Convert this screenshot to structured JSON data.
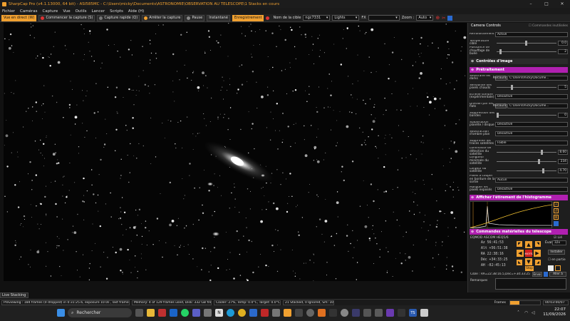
{
  "window": {
    "title": "SharpCap Pro (v4.1.13000, 64 bit) - ASI585MC - C:\\Users\\micky\\Documents\\ASTRONOMIE\\OBSERVATION AU TELESCOPE\\1 Stacks en cours",
    "minimize": "–",
    "maximize": "□",
    "close": "✕"
  },
  "menu": [
    "Fichier",
    "Caméras",
    "Capture",
    "Vue",
    "Outils",
    "Lancer",
    "Scripts",
    "Aide (H)"
  ],
  "toolbar": {
    "live_view": "Vue en direct (W)",
    "start_capture": "Commencer la capture (S)",
    "quick_capture": "Capture rapide (Q)",
    "stop_capture": "Arrêter la capture",
    "pause": "Pause",
    "snapshot": "Instantané",
    "save": "Enregistrement",
    "target_label": "Nom de la cible",
    "target_value": "ngc7331",
    "lights_value": "Lights",
    "fx_label": "FX",
    "zoom_label": "Zoom :",
    "zoom_value": "Auto"
  },
  "panel": {
    "camera_controls": "Camera Controls",
    "hide_unused": "Commandes inutilisées",
    "cooling_label": "Refroidissement",
    "cooling_value": "Activé",
    "target_temp_label": "Température cible",
    "target_temp_value": "0.0",
    "heater_label": "Puissance de chauffage de buée",
    "heater_value": "2",
    "image_controls": "Contrôles d'image",
    "preprocessing": "Prétraitement",
    "subtract_dark_label": "Soustraire les darks",
    "browse": "Parcourir...",
    "dark_path": "C:\\Users\\micky\\Docume...",
    "hot_pixel_label": "Sensibilité des pixels chauds",
    "hot_pixel_value": "5",
    "dark_scale_label": "Échelle sombre (expérimentale)",
    "dark_scale_value": "Désactivé",
    "flat_label": "Division par les flats",
    "flat_path": "C:\\Users\\micky\\Docume...",
    "banding_label": "Suppression des bandes",
    "banding_value": "0",
    "planet_label": "Stabilisation planète / disque",
    "planet_value": "Désactivé",
    "amp_glow_label": "Soustraction d'ombre plan",
    "amp_glow_value": "Désactivé",
    "trails_label": "Supprimer les traces satellites",
    "trails_value": "Faible",
    "detect_label": "Luminosité de détection du satellite",
    "detect_value": "8.60",
    "min_len_label": "Longueur minimale du satellite",
    "min_len_value": "234",
    "width_label": "Largeur du satellite",
    "width_value": "4.70",
    "border_label": "Pixels à couper en bordure de la sortie",
    "border_value": "Aucun",
    "mask_label": "Masquer les pixels exposés",
    "mask_value": "Désactivé",
    "histogram_header": "Afficher l'étirement de l'histogramme",
    "telescope_header": "Commandes matérielles du télescope",
    "mount_name": "EQMOD ASCOM HEQ5/6",
    "link_label": "Lié",
    "az": "Az   56:41:53",
    "alt": "Alt  +56:51:38",
    "ra": "RA   22:38:16",
    "dec": "Déc  +34:33:25",
    "ah": "AH   -02:45:13",
    "speed_label": "Évaluer",
    "speed_value": "32x",
    "install_label": "Installer",
    "tracking_label": "en partie",
    "center_label": "MOTS",
    "stop_label": "Stop",
    "target_text": "Cible : RA=22:38:16.5,Dec=+34:33:25",
    "goto_label": "Envoi",
    "goto_btn": "Aller à",
    "remarks_label": "Remarques"
  },
  "live_stacking": "Live Stacking",
  "status": {
    "preview": "Previewing : 184 frames (0 dropped) in 0:31:25.6, exposure 10.0s , last frame 10.0s",
    "memory": "Memory: 4 of 129 frames used, Disk: 332 GB free",
    "cooler": "Cooler: 27%, Temp: 0.0°C, Target: 0.0°C",
    "stacked": "21 Stacked, 0 Ignored, Sm: 10s",
    "frames_label": "Frames",
    "time": "00:03:00/07"
  },
  "taskbar": {
    "search": "Rechercher",
    "time": "22:07",
    "date": "11/09/2026"
  },
  "colors": {
    "accent": "#f0a030",
    "magenta": "#b020b0"
  }
}
